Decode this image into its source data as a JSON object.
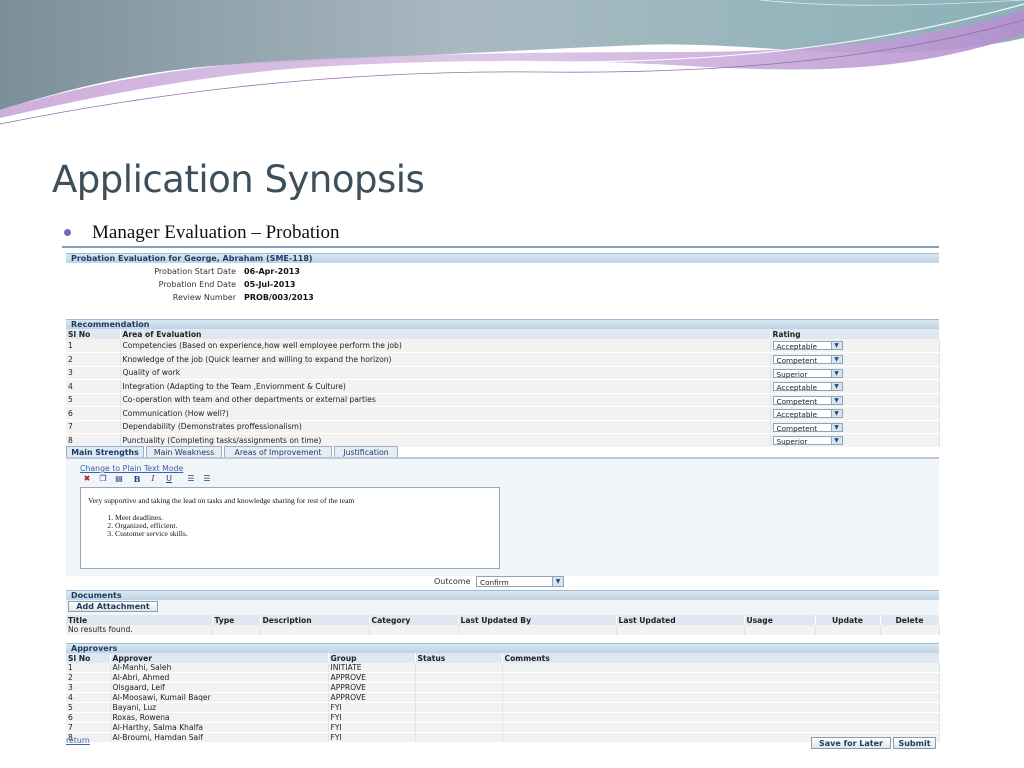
{
  "slide": {
    "title": "Application Synopsis",
    "bullet": "Manager  Evaluation – Probation"
  },
  "form": {
    "header_title": "Probation Evaluation for George, Abraham (SME-118)",
    "fields": [
      {
        "label": "Probation Start Date",
        "value": "06-Apr-2013"
      },
      {
        "label": "Probation End Date",
        "value": "05-Jul-2013"
      },
      {
        "label": "Review Number",
        "value": "PROB/003/2013"
      }
    ]
  },
  "recommendation": {
    "title": "Recommendation",
    "columns": [
      "Sl No",
      "Area of Evaluation",
      "Rating"
    ],
    "rows": [
      {
        "no": "1",
        "area": "Competencies (Based on experience,how well employee perform the job)",
        "rating": "Acceptable"
      },
      {
        "no": "2",
        "area": "Knowledge of the job (Quick learner and willing to expand the horizon)",
        "rating": "Competent"
      },
      {
        "no": "3",
        "area": "Quality of work",
        "rating": "Superior"
      },
      {
        "no": "4",
        "area": "Integration (Adapting to the Team ,Enviornment & Culture)",
        "rating": "Acceptable"
      },
      {
        "no": "5",
        "area": "Co-operation with team and other departments or external parties",
        "rating": "Competent"
      },
      {
        "no": "6",
        "area": "Communication (How well?)",
        "rating": "Acceptable"
      },
      {
        "no": "7",
        "area": "Dependability (Demonstrates proffessionalism)",
        "rating": "Competent"
      },
      {
        "no": "8",
        "area": "Punctuality (Completing tasks/assignments on time)",
        "rating": "Superior"
      }
    ]
  },
  "tabs": [
    "Main Strengths",
    "Main Weakness",
    "Areas of Improvement",
    "Justification"
  ],
  "editor": {
    "mode_link": "Change to Plain Text Mode",
    "toolbar_bold": "B",
    "toolbar_italic": "I",
    "toolbar_underline": "U",
    "intro": "Very supportive and taking the lead on tasks and knowledge sharing for rest of the team",
    "items": [
      "Meet deadlines.",
      "Organized, efficient.",
      "Customer service skills."
    ]
  },
  "outcome": {
    "label": "Outcome",
    "value": "Confirm"
  },
  "documents": {
    "title": "Documents",
    "add_button": "Add Attachment",
    "columns": [
      "Title",
      "Type",
      "Description",
      "Category",
      "Last Updated By",
      "Last Updated",
      "Usage",
      "Update",
      "Delete"
    ],
    "empty": "No results found."
  },
  "approvers": {
    "title": "Approvers",
    "columns": [
      "Sl No",
      "Approver",
      "Group",
      "Status",
      "Comments"
    ],
    "rows": [
      {
        "no": "1",
        "name": "Al-Manhi, Saleh",
        "group": "INITIATE"
      },
      {
        "no": "2",
        "name": "Al-Abri, Ahmed",
        "group": "APPROVE"
      },
      {
        "no": "3",
        "name": "Olsgaard, Leif",
        "group": "APPROVE"
      },
      {
        "no": "4",
        "name": "Al-Moosawi, Kumail Baqer",
        "group": "APPROVE"
      },
      {
        "no": "5",
        "name": "Bayani, Luz",
        "group": "FYI"
      },
      {
        "no": "6",
        "name": "Roxas, Rowena",
        "group": "FYI"
      },
      {
        "no": "7",
        "name": "Al-Harthy, Salma Khalfa",
        "group": "FYI"
      },
      {
        "no": "8",
        "name": "Al-Broumi, Hamdan Saif",
        "group": "FYI"
      }
    ]
  },
  "footer": {
    "return_link": "return",
    "save_button": "Save for Later",
    "submit_button": "Submit"
  }
}
